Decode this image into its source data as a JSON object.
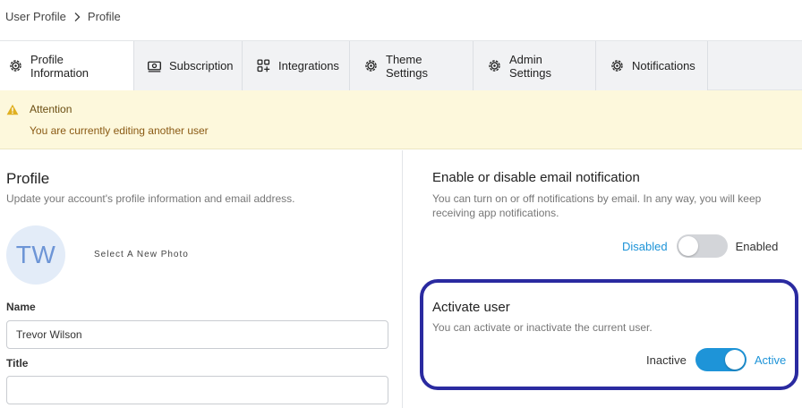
{
  "breadcrumb": {
    "parent": "User Profile",
    "current": "Profile"
  },
  "tabs": [
    {
      "label": "Profile Information",
      "icon": "gear-icon"
    },
    {
      "label": "Subscription",
      "icon": "money-icon"
    },
    {
      "label": "Integrations",
      "icon": "apps-plus-icon"
    },
    {
      "label": "Theme Settings",
      "icon": "gear-icon"
    },
    {
      "label": "Admin Settings",
      "icon": "gear-icon"
    },
    {
      "label": "Notifications",
      "icon": "gear-icon"
    }
  ],
  "alert": {
    "title": "Attention",
    "message": "You are currently editing another user",
    "icon": "warning-icon",
    "color": "#fdf8dc"
  },
  "profile": {
    "title": "Profile",
    "subtitle": "Update your account's profile information and email address.",
    "avatar_initials": "TW",
    "select_photo": "Select A New Photo",
    "name_label": "Name",
    "name_value": "Trevor Wilson",
    "title_label": "Title",
    "title_value": ""
  },
  "email_notifications": {
    "title": "Enable or disable email notification",
    "description": "You can turn on or off notifications by email. In any way, you will keep receiving app notifications.",
    "off_label": "Disabled",
    "on_label": "Enabled",
    "enabled": false
  },
  "activate_user": {
    "title": "Activate user",
    "description": "You can activate or inactivate the current user.",
    "off_label": "Inactive",
    "on_label": "Active",
    "active": true
  },
  "colors": {
    "accent": "#1e94d8",
    "highlight": "#2a2aa0"
  }
}
